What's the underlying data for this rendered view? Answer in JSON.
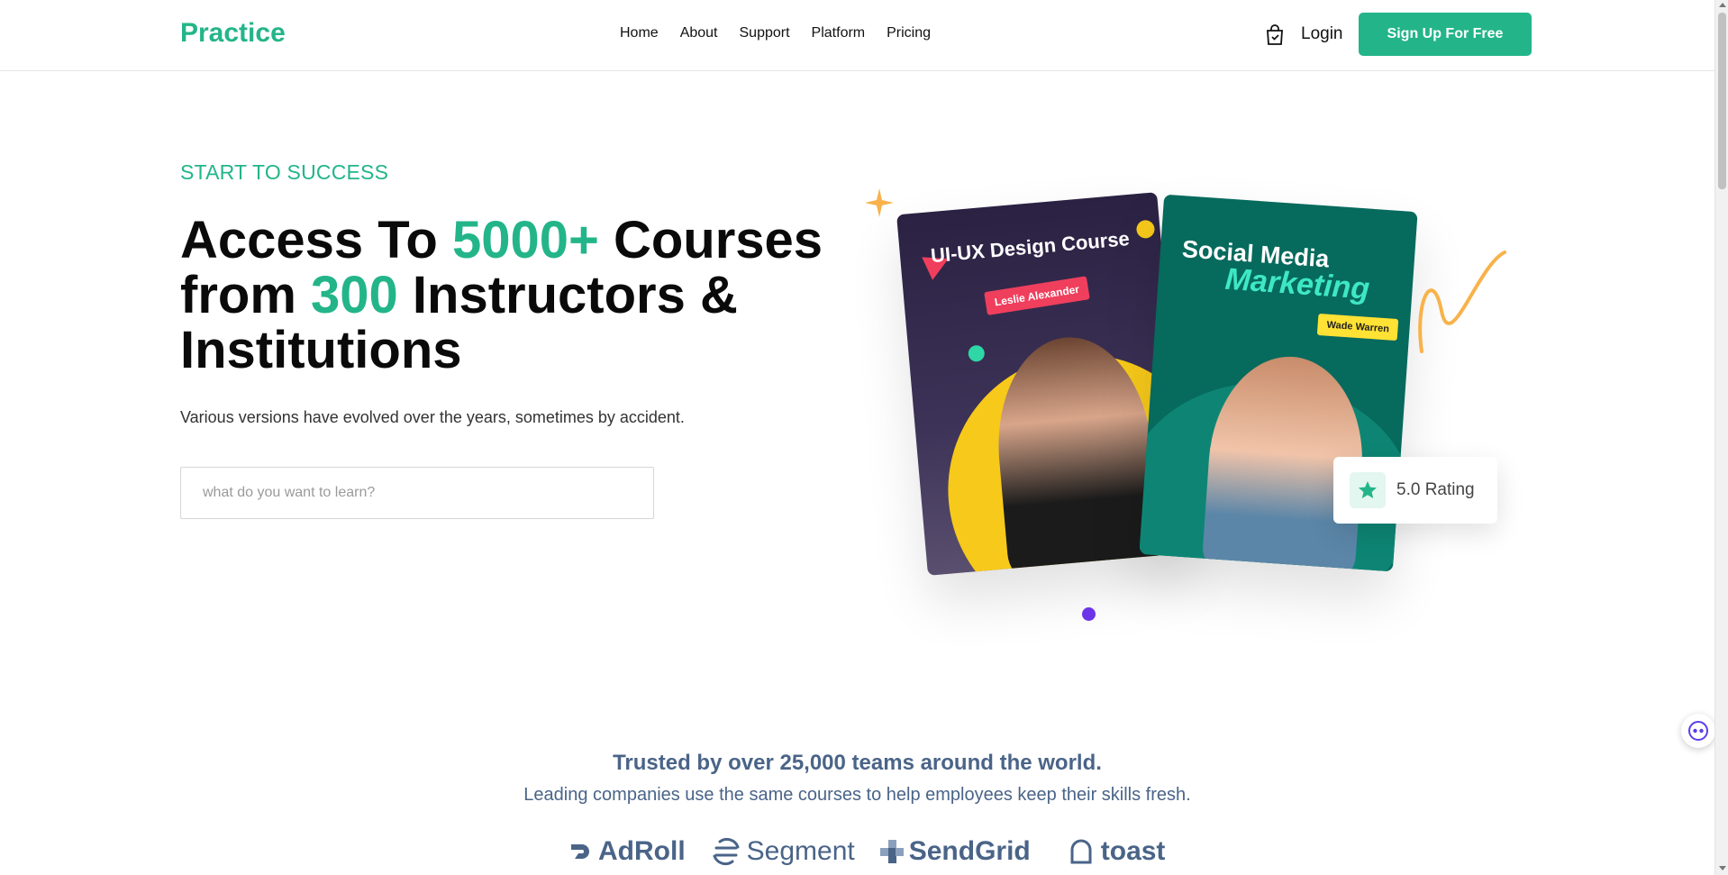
{
  "header": {
    "logo": "Practice",
    "nav": [
      "Home",
      "About",
      "Support",
      "Platform",
      "Pricing"
    ],
    "cart_icon": "shopping-bag-check-icon",
    "login": "Login",
    "signup": "Sign Up For Free"
  },
  "hero": {
    "eyebrow": "START TO SUCCESS",
    "headline": {
      "part1": "Access To ",
      "accent1": "5000+",
      "part2": " Courses from ",
      "accent2": "300",
      "part3": " Instructors & Institutions"
    },
    "subtext": "Various versions have evolved over the years, sometimes by accident.",
    "search_placeholder": "what do you want to learn?",
    "accent_color": "#23b589"
  },
  "cards": [
    {
      "title": "UI-UX Design Course",
      "instructor": "Leslie Alexander"
    },
    {
      "title_line1": "Social Media",
      "title_line2": "Marketing",
      "instructor": "Wade Warren"
    }
  ],
  "rating": {
    "value": "5.0",
    "label": "Rating",
    "icon": "star-icon"
  },
  "trusted": {
    "title": "Trusted by over 25,000 teams around the world.",
    "subtitle": "Leading companies use the same courses to help employees keep their skills fresh.",
    "companies": [
      "AdRoll",
      "Segment",
      "SendGrid",
      "toast"
    ]
  }
}
